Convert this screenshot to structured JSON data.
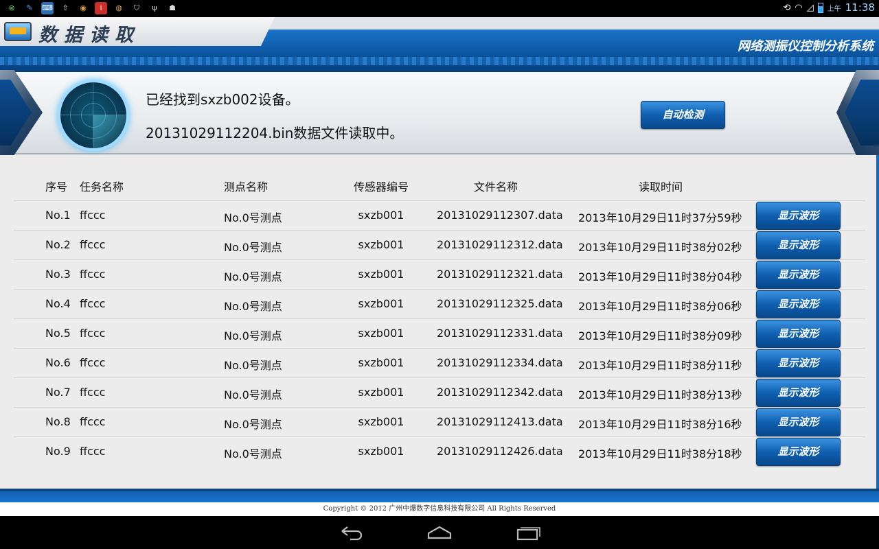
{
  "status_bar": {
    "left_icons": [
      "android-debug-icon",
      "brush-icon",
      "keyboard-icon",
      "upload-icon",
      "settings-app-icon",
      "info-app-icon",
      "globe-app-icon",
      "shield-app-icon",
      "usb-icon",
      "android-icon"
    ],
    "ampm": "上午",
    "time": "11:38"
  },
  "header": {
    "page_title": "数据读取",
    "system_title": "网络测振仪控制分析系统"
  },
  "status_panel": {
    "message1": "已经找到sxzb002设备。",
    "message2": "20131029112204.bin数据文件读取中。",
    "auto_detect_label": "自动检测"
  },
  "table": {
    "headers": {
      "no": "序号",
      "task": "任务名称",
      "point": "测点名称",
      "sensor": "传感器编号",
      "file": "文件名称",
      "time": "读取时间"
    },
    "button_label": "显示波形",
    "rows": [
      {
        "no": "No.1",
        "task": "ffccc",
        "point": "No.0号测点",
        "sensor": "sxzb001",
        "file": "20131029112307.data",
        "time": "2013年10月29日11时37分59秒"
      },
      {
        "no": "No.2",
        "task": "ffccc",
        "point": "No.0号测点",
        "sensor": "sxzb001",
        "file": "20131029112312.data",
        "time": "2013年10月29日11时38分02秒"
      },
      {
        "no": "No.3",
        "task": "ffccc",
        "point": "No.0号测点",
        "sensor": "sxzb001",
        "file": "20131029112321.data",
        "time": "2013年10月29日11时38分04秒"
      },
      {
        "no": "No.4",
        "task": "ffccc",
        "point": "No.0号测点",
        "sensor": "sxzb001",
        "file": "20131029112325.data",
        "time": "2013年10月29日11时38分06秒"
      },
      {
        "no": "No.5",
        "task": "ffccc",
        "point": "No.0号测点",
        "sensor": "sxzb001",
        "file": "20131029112331.data",
        "time": "2013年10月29日11时38分09秒"
      },
      {
        "no": "No.6",
        "task": "ffccc",
        "point": "No.0号测点",
        "sensor": "sxzb001",
        "file": "20131029112334.data",
        "time": "2013年10月29日11时38分11秒"
      },
      {
        "no": "No.7",
        "task": "ffccc",
        "point": "No.0号测点",
        "sensor": "sxzb001",
        "file": "20131029112342.data",
        "time": "2013年10月29日11时38分13秒"
      },
      {
        "no": "No.8",
        "task": "ffccc",
        "point": "No.0号测点",
        "sensor": "sxzb001",
        "file": "20131029112413.data",
        "time": "2013年10月29日11时38分16秒"
      },
      {
        "no": "No.9",
        "task": "ffccc",
        "point": "No.0号测点",
        "sensor": "sxzb001",
        "file": "20131029112426.data",
        "time": "2013年10月29日11时38分18秒"
      }
    ]
  },
  "footer": {
    "copyright": "Copyright © 2012 广州中爆数字信息科技有限公司 All Rights Reserved"
  },
  "colors": {
    "accent_blue": "#0f5fb0",
    "header_blue": "#1a73c8",
    "time_blue": "#9ed1ff"
  }
}
